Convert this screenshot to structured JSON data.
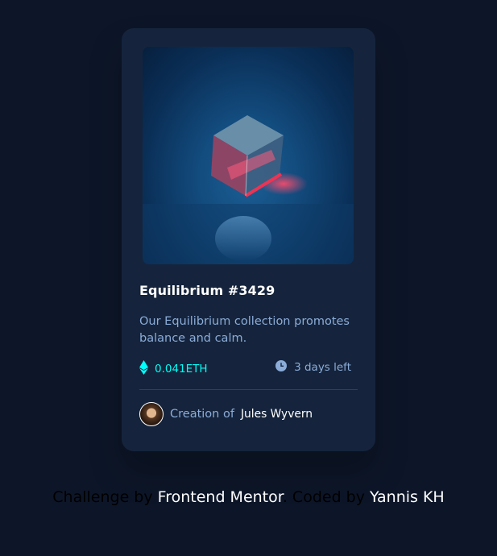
{
  "card": {
    "title": "Equilibrium #3429",
    "description": "Our Equilibrium collection promotes balance and calm.",
    "price": "0.041ETH",
    "time_left": "3 days left",
    "creator_label": "Creation of",
    "creator_name": "Jules Wyvern",
    "icons": {
      "image": "crystal-cube-image",
      "price": "ethereum-icon",
      "time": "clock-icon",
      "avatar": "creator-avatar"
    }
  },
  "attribution": {
    "challenge_by": "Challenge by",
    "mentor": "Frontend Mentor",
    "sep": ".",
    "coded_by": "Coded by",
    "author": "Yannis KH"
  },
  "colors": {
    "page_bg": "#0d1628",
    "card_bg": "#15243c",
    "accent_cyan": "#00fff8",
    "soft_blue": "#8bacd9",
    "white": "#ffffff"
  }
}
